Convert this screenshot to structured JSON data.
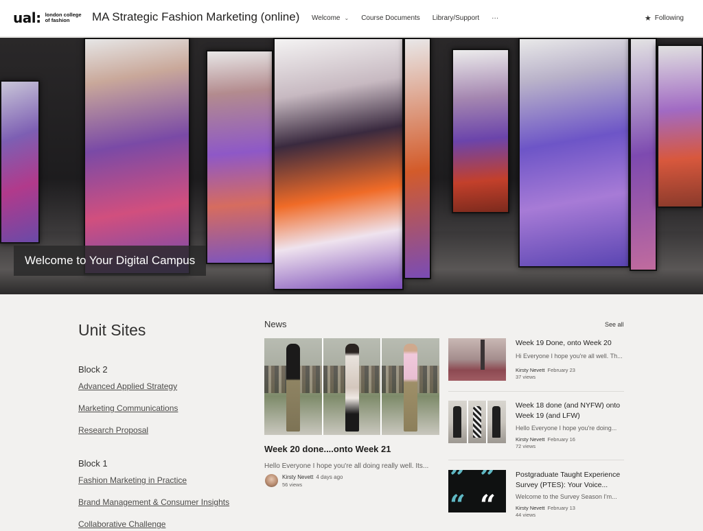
{
  "header": {
    "logo_ual": "ual:",
    "logo_college": "london college of fashion",
    "site_title": "MA Strategic Fashion Marketing (online)",
    "nav": [
      {
        "label": "Welcome",
        "has_dropdown": true
      },
      {
        "label": "Course Documents",
        "has_dropdown": false
      },
      {
        "label": "Library/Support",
        "has_dropdown": false
      },
      {
        "label": "···",
        "has_dropdown": false
      }
    ],
    "following_label": "Following",
    "following_icon": "star-icon"
  },
  "hero": {
    "caption": "Welcome to Your Digital Campus"
  },
  "unit_sites": {
    "title": "Unit Sites",
    "blocks": [
      {
        "heading": "Block 2",
        "links": [
          "Advanced Applied Strategy",
          "Marketing Communications",
          "Research Proposal"
        ]
      },
      {
        "heading": "Block 1",
        "links": [
          "Fashion Marketing in Practice",
          "Brand Management & Consumer Insights",
          "Collaborative Challenge"
        ]
      }
    ]
  },
  "news": {
    "heading": "News",
    "see_all": "See all",
    "featured": {
      "title": "Week 20 done....onto Week 21",
      "description": "Hello Everyone I hope you're all doing really well.  Its...",
      "author": "Kirsty Nevett",
      "date": "4 days ago",
      "views": "56 views"
    },
    "items": [
      {
        "title": "Week 19 Done, onto Week 20",
        "description": "Hi Everyone I hope you're all well. Th...",
        "author": "Kirsty Nevett",
        "date": "February 23",
        "views": "37 views"
      },
      {
        "title": "Week 18 done (and NYFW) onto Week 19 (and LFW)",
        "description": "Hello Everyone I hope you're doing...",
        "author": "Kirsty Nevett",
        "date": "February 16",
        "views": "72 views"
      },
      {
        "title": "Postgraduate Taught Experience Survey (PTES): Your Voice...",
        "description": "Welcome to the Survey Season I'm...",
        "author": "Kirsty Nevett",
        "date": "February 13",
        "views": "44 views"
      }
    ]
  },
  "colors": {
    "page_background": "#f2f1ef",
    "header_background": "#ffffff",
    "text": "#323130",
    "muted_text": "#605e5c",
    "quote_accent": "#5fb8c4"
  }
}
